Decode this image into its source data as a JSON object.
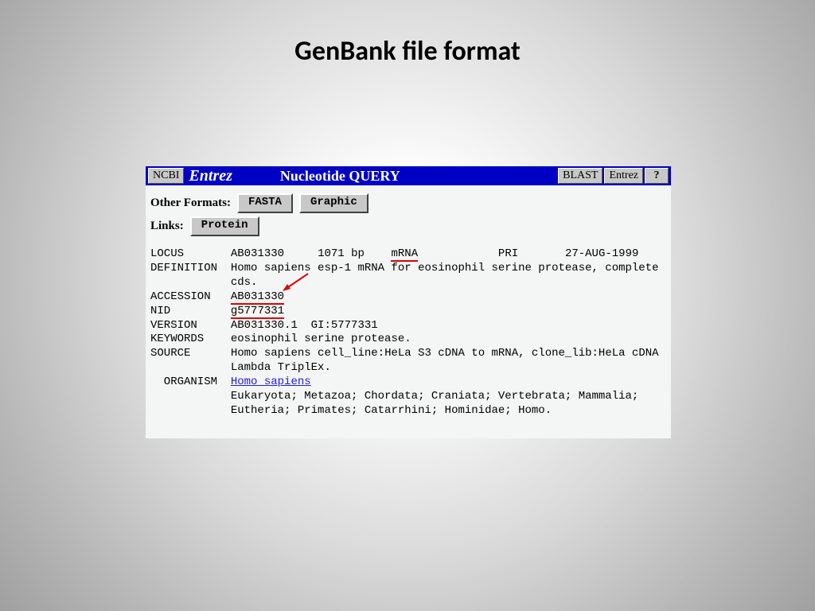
{
  "slide": {
    "title": "GenBank file format"
  },
  "topbar": {
    "ncbi": "NCBI",
    "brand": "Entrez",
    "title": "Nucleotide QUERY",
    "blast": "BLAST",
    "entrez": "Entrez",
    "help": "?"
  },
  "formats": {
    "label": "Other Formats:",
    "fasta": "FASTA",
    "graphic": "Graphic",
    "links_label": "Links:",
    "protein": "Protein"
  },
  "rec": {
    "locus_k": "LOCUS",
    "locus_name": "AB031330",
    "locus_len": "1071 bp",
    "locus_type": "mRNA",
    "locus_div": "PRI",
    "locus_date": "27-AUG-1999",
    "def_k": "DEFINITION",
    "def_v1": "Homo sapiens esp-1 mRNA for eosinophil serine protease, complete",
    "def_v2": "cds.",
    "acc_k": "ACCESSION",
    "acc_v": "AB031330",
    "nid_k": "NID",
    "nid_v": "g5777331",
    "ver_k": "VERSION",
    "ver_v": "AB031330.1  GI:5777331",
    "kw_k": "KEYWORDS",
    "kw_v": "eosinophil serine protease.",
    "src_k": "SOURCE",
    "src_v1": "Homo sapiens cell_line:HeLa S3 cDNA to mRNA, clone_lib:HeLa cDNA",
    "src_v2": "Lambda TriplEx.",
    "org_k": "  ORGANISM",
    "org_link": "Homo sapiens",
    "tax1": "Eukaryota; Metazoa; Chordata; Craniata; Vertebrata; Mammalia;",
    "tax2": "Eutheria; Primates; Catarrhini; Hominidae; Homo."
  }
}
